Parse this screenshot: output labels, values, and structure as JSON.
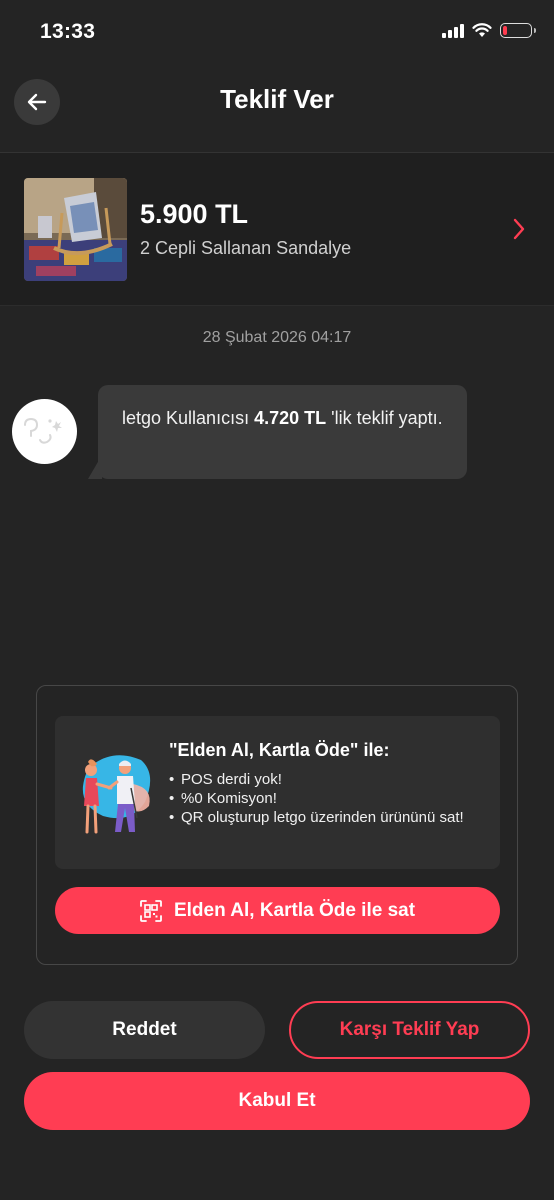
{
  "status_bar": {
    "time": "13:33",
    "battery_level": 0.15
  },
  "header": {
    "title": "Teklif Ver"
  },
  "product": {
    "price": "5.900 TL",
    "name": "2 Cepli Sallanan Sandalye"
  },
  "chat": {
    "timestamp": "28 Şubat 2026 04:17",
    "message_prefix": "letgo Kullanıcısı",
    "message_amount": "4.720 TL",
    "message_suffix": "'lik teklif yaptı."
  },
  "promo": {
    "title": "\"Elden Al, Kartla Öde\" ile:",
    "bullets": [
      "POS derdi yok!",
      "%0 Komisyon!",
      "QR oluşturup letgo üzerinden ürününü sat!"
    ],
    "button_label": "Elden Al, Kartla Öde ile sat"
  },
  "actions": {
    "reject_label": "Reddet",
    "counter_label": "Karşı Teklif Yap",
    "accept_label": "Kabul Et"
  },
  "colors": {
    "accent": "#ff3d53",
    "background": "#242424"
  },
  "icons": [
    "back-arrow-icon",
    "chevron-right-icon",
    "qr-code-icon",
    "wifi-icon",
    "signal-icon",
    "battery-icon"
  ]
}
